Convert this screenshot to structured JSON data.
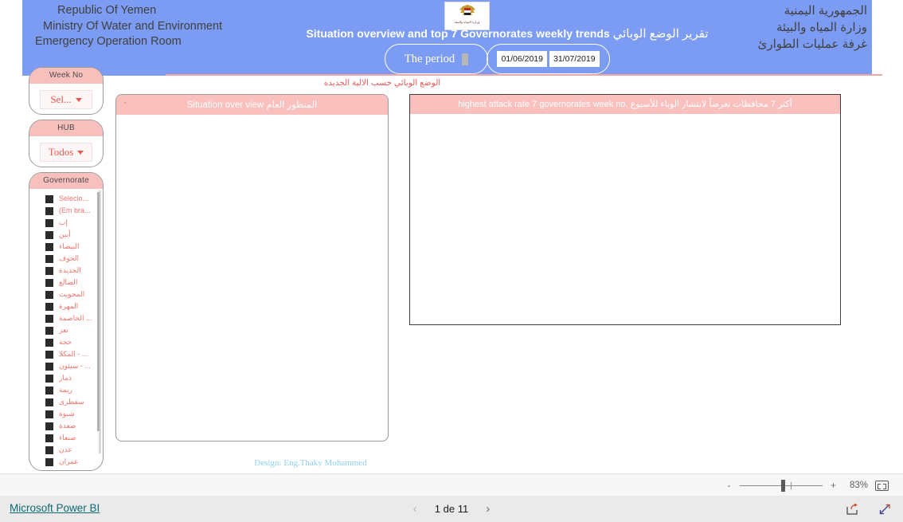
{
  "header": {
    "org_en": [
      "Republic Of Yemen",
      "Ministry Of Water and Environment",
      "Emergency Operation Room"
    ],
    "org_ar": [
      "الجمهورية اليمنية",
      "وزارة المياه والبيئة",
      "غرفة عمليات الطوارئ"
    ],
    "emblem_caption": "وزارة المياه والبيئة",
    "title_en": "Situation overview and top 7 Governorates weekly trends",
    "title_ar": "تقرير الوضع الوبائي",
    "period_label": "The period",
    "date_from": "01/06/2019",
    "date_to": "31/07/2019",
    "sub_note": "الوضع الوبائي حسب الالية الجديده",
    "band_color": "#7b9cf2",
    "accent_color": "#f8c0bd"
  },
  "slicers": {
    "week": {
      "title": "Week No",
      "value": "Sel..."
    },
    "hub": {
      "title": "HUB",
      "value": "Todos"
    },
    "governorate": {
      "title": "Governorate",
      "items": [
        {
          "label": "Selecio...",
          "ltr": true
        },
        {
          "label": "(Em bra...",
          "ltr": true
        },
        {
          "label": "إب",
          "ltr": false
        },
        {
          "label": "أبين",
          "ltr": false
        },
        {
          "label": "البيضاء",
          "ltr": false
        },
        {
          "label": "الجوف",
          "ltr": false
        },
        {
          "label": "الحديدة",
          "ltr": false
        },
        {
          "label": "الضالع",
          "ltr": false
        },
        {
          "label": "المحويت",
          "ltr": false
        },
        {
          "label": "المهرة",
          "ltr": false
        },
        {
          "label": "... الخاصمة",
          "ltr": false
        },
        {
          "label": "تعز",
          "ltr": false
        },
        {
          "label": "حجة",
          "ltr": false
        },
        {
          "label": "... - المكلا",
          "ltr": false
        },
        {
          "label": "... - سيئون",
          "ltr": false
        },
        {
          "label": "ذمار",
          "ltr": false
        },
        {
          "label": "ريمة",
          "ltr": false
        },
        {
          "label": "سقطرى",
          "ltr": false
        },
        {
          "label": "شبوة",
          "ltr": false
        },
        {
          "label": "صعدة",
          "ltr": false
        },
        {
          "label": "صنعاء",
          "ltr": false
        },
        {
          "label": "عدن",
          "ltr": false
        },
        {
          "label": "عمران",
          "ltr": false
        }
      ]
    }
  },
  "panels": {
    "left": {
      "title_en": "Situation over view",
      "title_ar": "المنظور العام"
    },
    "right": {
      "title": "أكثر 7 محافظات تعرضاً لانتشار الوباء للأسبوع .highest attack rate 7 governorates week no"
    }
  },
  "credit": "Design: Eng.Thaky Mohammed",
  "status_bar": {
    "zoom_minus": "-",
    "zoom_plus": "+",
    "zoom_value": "83%",
    "fit_label": "fit-to-page"
  },
  "footer": {
    "brand": "Microsoft Power BI",
    "prev": "‹",
    "next": "›",
    "page_label": "1 de 11",
    "share_label": "share",
    "fullscreen_label": "fullscreen"
  }
}
